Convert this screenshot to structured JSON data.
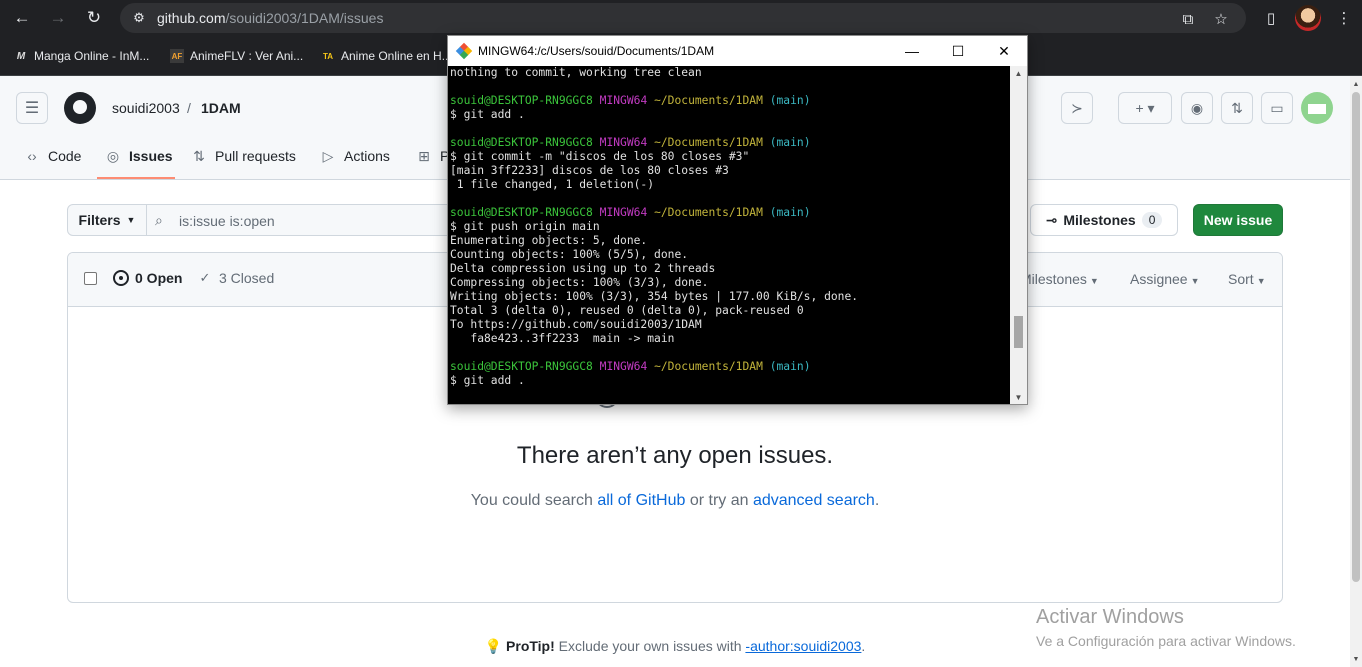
{
  "browser": {
    "url_host": "github.com",
    "url_path": "/souidi2003/1DAM/issues",
    "bookmarks": [
      {
        "icon": "M",
        "label": "Manga Online - InM..."
      },
      {
        "icon": "AF",
        "label": "AnimeFLV : Ver Ani..."
      },
      {
        "icon": "TA",
        "label": "Anime Online en H..."
      }
    ]
  },
  "github": {
    "owner": "souidi2003",
    "separator": "/",
    "repo": "1DAM",
    "tabs": [
      {
        "label": "Code",
        "icon": "code-icon"
      },
      {
        "label": "Issues",
        "icon": "issue-opened-icon"
      },
      {
        "label": "Pull requests",
        "icon": "git-pull-request-icon"
      },
      {
        "label": "Actions",
        "icon": "play-icon"
      },
      {
        "label": "P",
        "icon": "table-icon"
      }
    ],
    "filters_label": "Filters",
    "search_value": "is:issue is:open",
    "milestones_label": "Milestones",
    "milestones_count": "0",
    "new_issue_label": "New issue",
    "open_label": "0 Open",
    "closed_label": "3 Closed",
    "sort_menus": {
      "milestones": "Milestones",
      "assignee": "Assignee",
      "sort": "Sort"
    },
    "blank_title": "There aren’t any open issues.",
    "blank_text_prefix": "You could search ",
    "blank_link_1": "all of GitHub",
    "blank_text_mid": " or try an ",
    "blank_link_2": "advanced search",
    "blank_text_suffix": ".",
    "protip_label": "ProTip!",
    "protip_text": " Exclude your own issues with ",
    "protip_link": "-author:souidi2003",
    "protip_suffix": "."
  },
  "windows_watermark": {
    "line1": "Activar Windows",
    "line2": "Ve a Configuración para activar Windows."
  },
  "terminal": {
    "title": "MINGW64:/c/Users/souid/Documents/1DAM",
    "prompt_user": "souid@DESKTOP-RN9GGC8",
    "prompt_env": "MINGW64",
    "prompt_path": "~/Documents/1DAM",
    "prompt_branch": "(main)",
    "line_status": "nothing to commit, working tree clean",
    "cmd_add": "$ git add .",
    "cmd_commit": "$ git commit -m \"discos de los 80 closes #3\"",
    "commit_out_1": "[main 3ff2233] discos de los 80 closes #3",
    "commit_out_2": " 1 file changed, 1 deletion(-)",
    "cmd_push": "$ git push origin main",
    "push_out": [
      "Enumerating objects: 5, done.",
      "Counting objects: 100% (5/5), done.",
      "Delta compression using up to 2 threads",
      "Compressing objects: 100% (3/3), done.",
      "Writing objects: 100% (3/3), 354 bytes | 177.00 KiB/s, done.",
      "Total 3 (delta 0), reused 0 (delta 0), pack-reused 0",
      "To https://github.com/souidi2003/1DAM",
      "   fa8e423..3ff2233  main -> main"
    ],
    "cmd_add_final": "$ git add ."
  }
}
